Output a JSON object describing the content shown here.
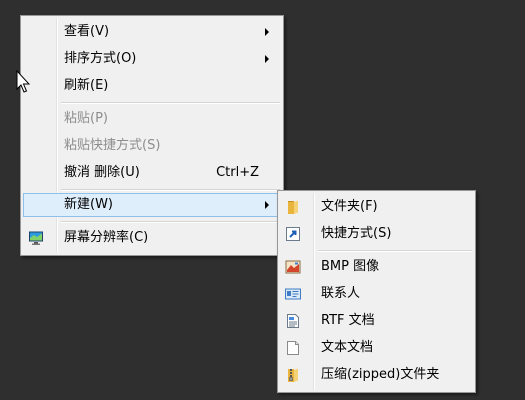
{
  "context_menu": {
    "items": [
      {
        "label": "查看(V)",
        "has_submenu": true
      },
      {
        "label": "排序方式(O)",
        "has_submenu": true
      },
      {
        "label": "刷新(E)"
      },
      {
        "label": "粘贴(P)",
        "disabled": true
      },
      {
        "label": "粘贴快捷方式(S)",
        "disabled": true
      },
      {
        "label": "撤消 删除(U)",
        "shortcut": "Ctrl+Z"
      },
      {
        "label": "新建(W)",
        "has_submenu": true,
        "highlighted": true
      },
      {
        "label": "屏幕分辨率(C)",
        "icon": "display-icon"
      }
    ]
  },
  "new_submenu": {
    "items": [
      {
        "label": "文件夹(F)",
        "icon": "folder-icon"
      },
      {
        "label": "快捷方式(S)",
        "icon": "shortcut-icon"
      },
      {
        "label": "BMP 图像",
        "icon": "bitmap-image-icon"
      },
      {
        "label": "联系人",
        "icon": "contact-card-icon"
      },
      {
        "label": "RTF 文档",
        "icon": "rtf-document-icon"
      },
      {
        "label": "文本文档",
        "icon": "text-document-icon"
      },
      {
        "label": "压缩(zipped)文件夹",
        "icon": "zip-folder-icon"
      }
    ]
  },
  "colors": {
    "desktop_background": "#2f2f2f",
    "menu_background": "#f0f0f0",
    "highlight_fill": "#dfeefb",
    "highlight_border": "#8fc0e9",
    "disabled_text": "#8d8d8d"
  }
}
